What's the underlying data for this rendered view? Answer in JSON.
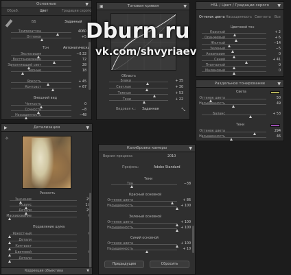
{
  "basic": {
    "title": "Основные",
    "tabs": [
      "Обраб.",
      "Цвет",
      "Градации серого"
    ],
    "wb_label": "ББ",
    "wb_value": "Заданный",
    "rows1": [
      {
        "label": "Температура",
        "value": "4060",
        "pos": 0.78
      },
      {
        "label": "Оттенок",
        "value": "+5",
        "pos": 0.52
      }
    ],
    "tone_label": "Тон",
    "tone_auto": "Автоматически",
    "rows2": [
      {
        "label": "Экспозиция",
        "value": "−0.32",
        "pos": 0.46
      },
      {
        "label": "Восстановление",
        "value": "72",
        "pos": 0.72
      },
      {
        "label": "Заполняющий свет",
        "value": "28",
        "pos": 0.3
      },
      {
        "label": "Черные",
        "value": "18",
        "pos": 0.2
      }
    ],
    "rows3": [
      {
        "label": "Яркость",
        "value": "+ 45",
        "pos": 0.62
      },
      {
        "label": "Контраст",
        "value": "+ 67",
        "pos": 0.7
      }
    ],
    "presence": "Внешний вид",
    "rows4": [
      {
        "label": "Четкость",
        "value": "0",
        "pos": 0.5
      },
      {
        "label": "Сочность",
        "value": "−8",
        "pos": 0.46
      },
      {
        "label": "Насыщенность",
        "value": "−48",
        "pos": 0.26
      }
    ]
  },
  "curve": {
    "title": "Тоновая кривая",
    "region": "Область",
    "rows": [
      {
        "label": "Блики",
        "value": "+ 35",
        "pos": 0.66
      },
      {
        "label": "Светлые",
        "value": "+ 30",
        "pos": 0.64
      },
      {
        "label": "Темные",
        "value": "+ 53",
        "pos": 0.77
      },
      {
        "label": "Тени",
        "value": "+ 22",
        "pos": 0.6
      }
    ],
    "point_label": "Видовая к.:",
    "point_value": "Заданная"
  },
  "hsl": {
    "title": "HSL / Цвет / Градации серого",
    "tabs": [
      "Оттенок цвета",
      "Насыщенность",
      "Светлота",
      "Все"
    ],
    "group": "Цветовой тон",
    "rows": [
      {
        "label": "Красный",
        "value": "+ 2",
        "pos": 0.52
      },
      {
        "label": "Оранжевый",
        "value": "+ 6",
        "pos": 0.54
      },
      {
        "label": "Желтый",
        "value": "−14",
        "pos": 0.43
      },
      {
        "label": "Зеленый",
        "value": "−5",
        "pos": 0.48
      },
      {
        "label": "Аквамарин",
        "value": "0",
        "pos": 0.5
      },
      {
        "label": "Синий",
        "value": "+ 41",
        "pos": 0.7
      },
      {
        "label": "Пурпурный",
        "value": "0",
        "pos": 0.5
      },
      {
        "label": "Малиновый",
        "value": "0",
        "pos": 0.5
      }
    ]
  },
  "split": {
    "title": "Раздельное тонирование",
    "highlights": "Света",
    "hl_rows": [
      {
        "label": "Оттенок цвета",
        "value": "50",
        "pos": 0.14
      },
      {
        "label": "Насыщенность",
        "value": "49",
        "pos": 0.49
      }
    ],
    "balance": {
      "label": "Баланс",
      "value": "+ 53",
      "pos": 0.76
    },
    "shadows": "Тени",
    "sh_rows": [
      {
        "label": "Оттенок цвета",
        "value": "294",
        "pos": 0.82
      },
      {
        "label": "Насыщенность",
        "value": "46",
        "pos": 0.46
      }
    ],
    "hl_color": "#b6b35a",
    "sh_color": "#9b4fb3"
  },
  "detail": {
    "title": "Детализация",
    "sharpening": "Резкость",
    "sharp_rows": [
      {
        "label": "Значение",
        "value": "25",
        "pos": 0.17
      },
      {
        "label": "Радиус",
        "value": "1.0",
        "pos": 0.25
      },
      {
        "label": "Детали",
        "value": "25",
        "pos": 0.25
      },
      {
        "label": "Маскирование",
        "value": "0",
        "pos": 0.0
      }
    ],
    "noise": "Подавление шума",
    "noise_rows": [
      {
        "label": "Яркостный",
        "value": "0",
        "pos": 0.0
      },
      {
        "label": "Детали",
        "value": "",
        "pos": 0.0
      },
      {
        "label": "Контраст",
        "value": "",
        "pos": 0.0
      },
      {
        "label": "Цветовой",
        "value": "0",
        "pos": 0.0
      },
      {
        "label": "Детали",
        "value": "",
        "pos": 0.0
      }
    ],
    "lens": "Коррекция объектива"
  },
  "camera": {
    "title": "Калибровка камеры",
    "process_label": "Версия процесса",
    "process_value": "2010",
    "profile_label": "Профиль:",
    "profile_value": "Adobe Standard",
    "shadows_title": "Тени",
    "shadows_row": {
      "label": "Тон",
      "value": "−38",
      "pos": 0.32
    },
    "red_title": "Красный основной",
    "red_rows": [
      {
        "label": "Оттенок цвета",
        "value": "+ 86",
        "pos": 0.93
      },
      {
        "label": "Насыщенность",
        "value": "+ 100",
        "pos": 1.0
      }
    ],
    "green_title": "Зеленый основной",
    "green_rows": [
      {
        "label": "Оттенок цвета",
        "value": "+ 100",
        "pos": 1.0
      },
      {
        "label": "Насыщенность",
        "value": "+ 100",
        "pos": 1.0
      }
    ],
    "blue_title": "Синий основной",
    "blue_rows": [
      {
        "label": "Оттенок цвета",
        "value": "+ 100",
        "pos": 1.0
      },
      {
        "label": "Насыщенность",
        "value": "+ 10",
        "pos": 0.55
      }
    ],
    "btn_prev": "Предыдущее",
    "btn_reset": "Сбросить"
  },
  "watermark": {
    "line1": "Dburn.ru",
    "line2": "vk.com/shvyriaev"
  }
}
